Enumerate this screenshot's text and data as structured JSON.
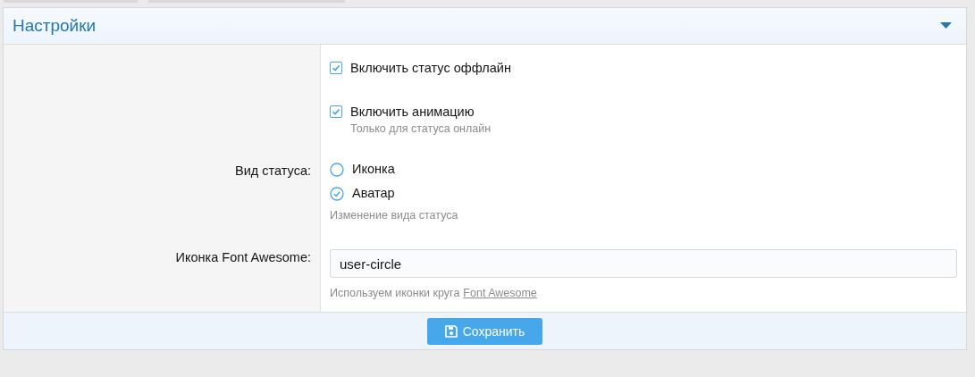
{
  "panel": {
    "title": "Настройки",
    "expanded": true
  },
  "options": [
    {
      "kind": "checkbox",
      "label": "Включить статус оффлайн",
      "checked": true
    },
    {
      "kind": "checkbox",
      "label": "Включить анимацию",
      "checked": true,
      "hint": "Только для статуса онлайн"
    },
    {
      "kind": "radio",
      "title": "Вид статуса:",
      "choices": [
        {
          "label": "Иконка",
          "selected": false
        },
        {
          "label": "Аватар",
          "selected": true
        }
      ],
      "hint": "Изменение вида статуса"
    },
    {
      "kind": "text",
      "title": "Иконка Font Awesome:",
      "value": "user-circle",
      "hint": "Используем иконки круга",
      "hint_link": "Font Awesome"
    }
  ],
  "save_button": "Сохранить"
}
